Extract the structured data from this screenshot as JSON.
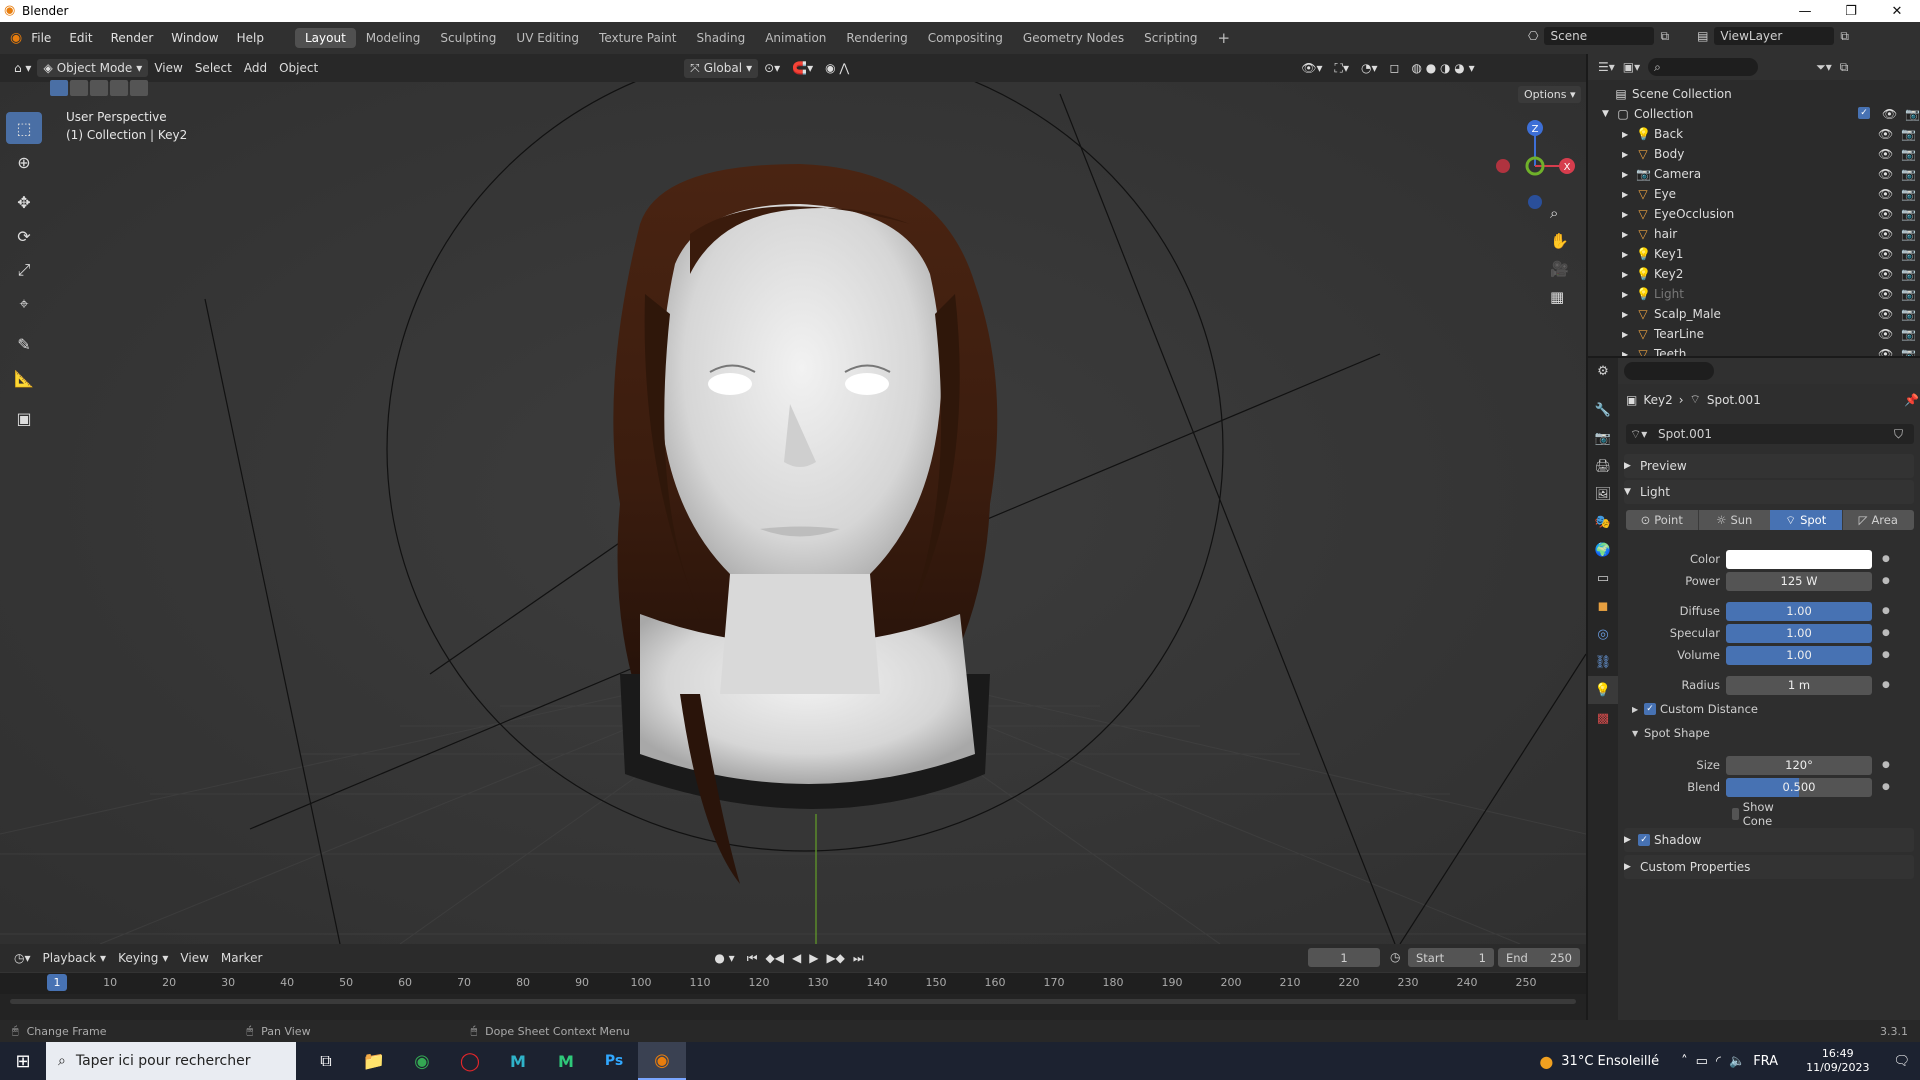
{
  "window": {
    "title": "Blender"
  },
  "menu": [
    "File",
    "Edit",
    "Render",
    "Window",
    "Help"
  ],
  "workspaces": [
    "Layout",
    "Modeling",
    "Sculpting",
    "UV Editing",
    "Texture Paint",
    "Shading",
    "Animation",
    "Rendering",
    "Compositing",
    "Geometry Nodes",
    "Scripting"
  ],
  "active_workspace": "Layout",
  "scene": {
    "scene_name": "Scene",
    "view_layer": "ViewLayer"
  },
  "viewport_header": {
    "mode": "Object Mode",
    "menus": [
      "View",
      "Select",
      "Add",
      "Object"
    ],
    "orientation": "Global",
    "options": "Options"
  },
  "viewport": {
    "perspective": "User Perspective",
    "collection_info": "(1) Collection | Key2",
    "gizmo": {
      "x": "X",
      "y": "Y",
      "z": "Z"
    }
  },
  "outliner": {
    "root": "Scene Collection",
    "collection": "Collection",
    "items": [
      {
        "name": "Back",
        "kind": "light"
      },
      {
        "name": "Body",
        "kind": "mesh"
      },
      {
        "name": "Camera",
        "kind": "camera"
      },
      {
        "name": "Eye",
        "kind": "mesh"
      },
      {
        "name": "EyeOcclusion",
        "kind": "mesh"
      },
      {
        "name": "hair",
        "kind": "mesh"
      },
      {
        "name": "Key1",
        "kind": "light"
      },
      {
        "name": "Key2",
        "kind": "light"
      },
      {
        "name": "Light",
        "kind": "light"
      },
      {
        "name": "Scalp_Male",
        "kind": "mesh"
      },
      {
        "name": "TearLine",
        "kind": "mesh"
      },
      {
        "name": "Teeth",
        "kind": "mesh"
      }
    ]
  },
  "properties": {
    "breadcrumb_object": "Key2",
    "breadcrumb_data": "Spot.001",
    "datablock": "Spot.001",
    "preview_label": "Preview",
    "light_label": "Light",
    "light_types": [
      "Point",
      "Sun",
      "Spot",
      "Area"
    ],
    "active_type": "Spot",
    "color_label": "Color",
    "power_label": "Power",
    "power": "125 W",
    "diffuse_label": "Diffuse",
    "diffuse": "1.00",
    "specular_label": "Specular",
    "specular": "1.00",
    "volume_label": "Volume",
    "volume": "1.00",
    "radius_label": "Radius",
    "radius": "1 m",
    "custom_distance": "Custom Distance",
    "spot_shape": "Spot Shape",
    "size_label": "Size",
    "size": "120°",
    "blend_label": "Blend",
    "blend": "0.500",
    "blend_fraction": 0.5,
    "show_cone": "Show Cone",
    "shadow": "Shadow",
    "custom_properties": "Custom Properties",
    "light_color": "#ffffff",
    "accent": "#4772b3"
  },
  "timeline": {
    "menus": [
      "Playback",
      "Keying",
      "View",
      "Marker"
    ],
    "current_frame": "1",
    "start_label": "Start",
    "start": "1",
    "end_label": "End",
    "end": "250",
    "ticks": [
      "1",
      "10",
      "20",
      "30",
      "40",
      "50",
      "60",
      "70",
      "80",
      "90",
      "100",
      "110",
      "120",
      "130",
      "140",
      "150",
      "160",
      "170",
      "180",
      "190",
      "200",
      "210",
      "220",
      "230",
      "240",
      "250"
    ]
  },
  "status": {
    "left": "Change Frame",
    "middle": "Pan View",
    "right": "Dope Sheet Context Menu",
    "version": "3.3.1"
  },
  "taskbar": {
    "search_placeholder": "Taper ici pour rechercher",
    "weather": "31°C Ensoleillé",
    "lang": "FRA",
    "time": "16:49",
    "date": "11/09/2023"
  }
}
